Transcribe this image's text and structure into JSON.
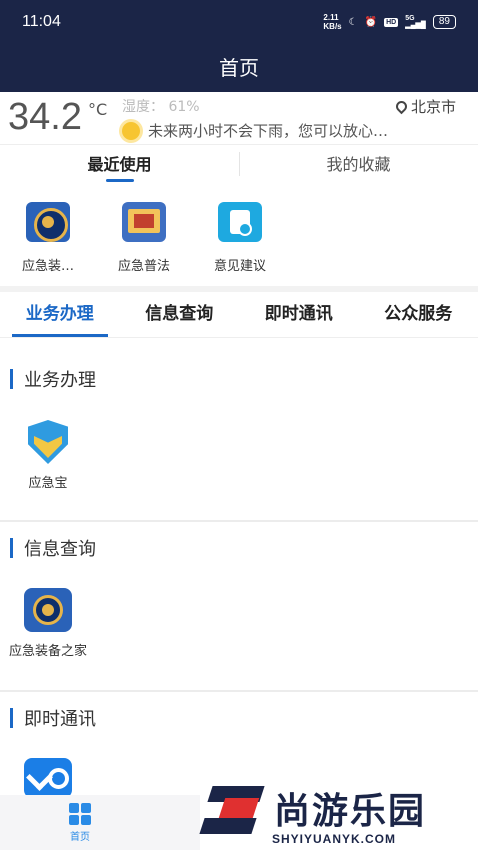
{
  "status_bar": {
    "time": "11:04",
    "speed_value": "2.11",
    "speed_unit": "KB/s",
    "hd": "HD",
    "network": "5G",
    "battery": "89"
  },
  "header": {
    "title": "首页"
  },
  "weather": {
    "temperature": "34.2",
    "unit": "°C",
    "humidity": "湿度： 61%",
    "city": "北京市",
    "forecast": "未来两小时不会下雨，您可以放心…"
  },
  "recent_tabs": [
    {
      "label": "最近使用"
    },
    {
      "label": "我的收藏"
    }
  ],
  "recent_apps": [
    {
      "label": "应急装…",
      "icon": "emergency-badge-icon"
    },
    {
      "label": "应急普法",
      "icon": "law-book-icon"
    },
    {
      "label": "意见建议",
      "icon": "feedback-icon"
    }
  ],
  "category_tabs": [
    {
      "label": "业务办理"
    },
    {
      "label": "信息查询"
    },
    {
      "label": "即时通讯"
    },
    {
      "label": "公众服务"
    }
  ],
  "sections": [
    {
      "title": "业务办理",
      "apps": [
        {
          "label": "应急宝",
          "icon": "shield-icon"
        }
      ]
    },
    {
      "title": "信息查询",
      "apps": [
        {
          "label": "应急装备之家",
          "icon": "emergency-badge-icon"
        }
      ]
    },
    {
      "title": "即时通讯",
      "apps": [
        {
          "label": "",
          "icon": "chat-app-icon"
        }
      ]
    }
  ],
  "bottom_nav": [
    {
      "label": "首页",
      "icon": "home-grid-icon"
    }
  ],
  "watermark": {
    "text_cn": "尚游乐园",
    "text_en": "SHYIYUANYK.COM"
  },
  "colors": {
    "header_bg": "#1b2547",
    "accent": "#1b68c6"
  }
}
